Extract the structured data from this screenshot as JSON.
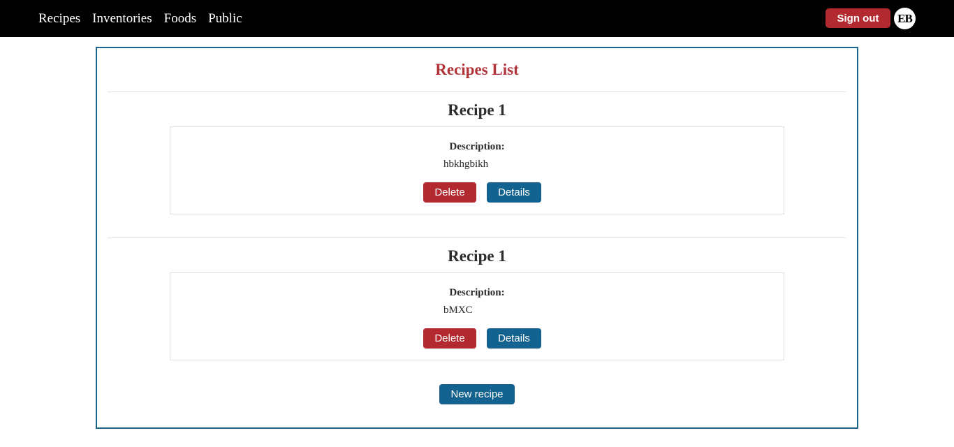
{
  "nav": {
    "links": [
      "Recipes",
      "Inventories",
      "Foods",
      "Public"
    ],
    "signout_label": "Sign out",
    "avatar_initials": "EB"
  },
  "main": {
    "title": "Recipes List",
    "recipes": [
      {
        "name": "Recipe 1",
        "description_label": "Description:",
        "description": "hbkhgbikh",
        "delete_label": "Delete",
        "details_label": "Details"
      },
      {
        "name": "Recipe 1",
        "description_label": "Description:",
        "description": "bMXC",
        "delete_label": "Delete",
        "details_label": "Details"
      }
    ],
    "new_recipe_label": "New recipe"
  },
  "colors": {
    "navbar_bg": "#000000",
    "danger": "#b22a2f",
    "primary": "#13628f",
    "title_red": "#b0343a",
    "panel_border": "#1c6389"
  }
}
